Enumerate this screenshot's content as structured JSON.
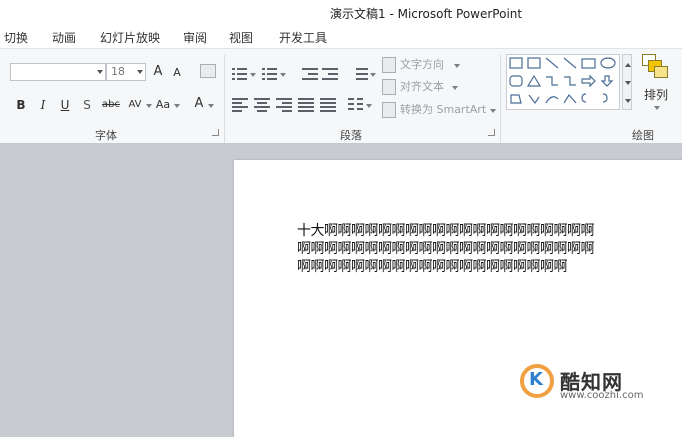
{
  "window": {
    "title": "演示文稿1 - Microsoft PowerPoint"
  },
  "tabs": [
    {
      "label": "切换"
    },
    {
      "label": "动画"
    },
    {
      "label": "幻灯片放映"
    },
    {
      "label": "审阅"
    },
    {
      "label": "视图"
    },
    {
      "label": "开发工具"
    }
  ],
  "ribbon": {
    "font_group": {
      "label": "字体",
      "font_name": "",
      "font_size": "18",
      "grow_label": "A",
      "shrink_label": "A",
      "bold": "B",
      "italic": "I",
      "underline": "U",
      "shadow": "S",
      "strike": "abc",
      "spacing": "AV",
      "case": "Aa",
      "color": "A"
    },
    "paragraph_group": {
      "label": "段落",
      "text_direction": "文字方向",
      "align_text": "对齐文本",
      "convert_smartart": "转换为 SmartArt"
    },
    "drawing_group": {
      "label": "绘图",
      "arrange": "排列"
    }
  },
  "slide": {
    "text_line1": "十大啊啊啊啊啊啊啊啊啊啊啊啊啊啊啊啊啊啊啊啊",
    "text_line2": "啊啊啊啊啊啊啊啊啊啊啊啊啊啊啊啊啊啊啊啊啊啊",
    "text_line3": "啊啊啊啊啊啊啊啊啊啊啊啊啊啊啊啊啊啊啊啊"
  },
  "watermark": {
    "logo_letter": "K",
    "brand": "酷知网",
    "url": "www.coozhi.com"
  },
  "colors": {
    "watermark_ring": "#f0a040",
    "watermark_k": "#2f7fcc",
    "arrange_icon": "#f5c400"
  }
}
